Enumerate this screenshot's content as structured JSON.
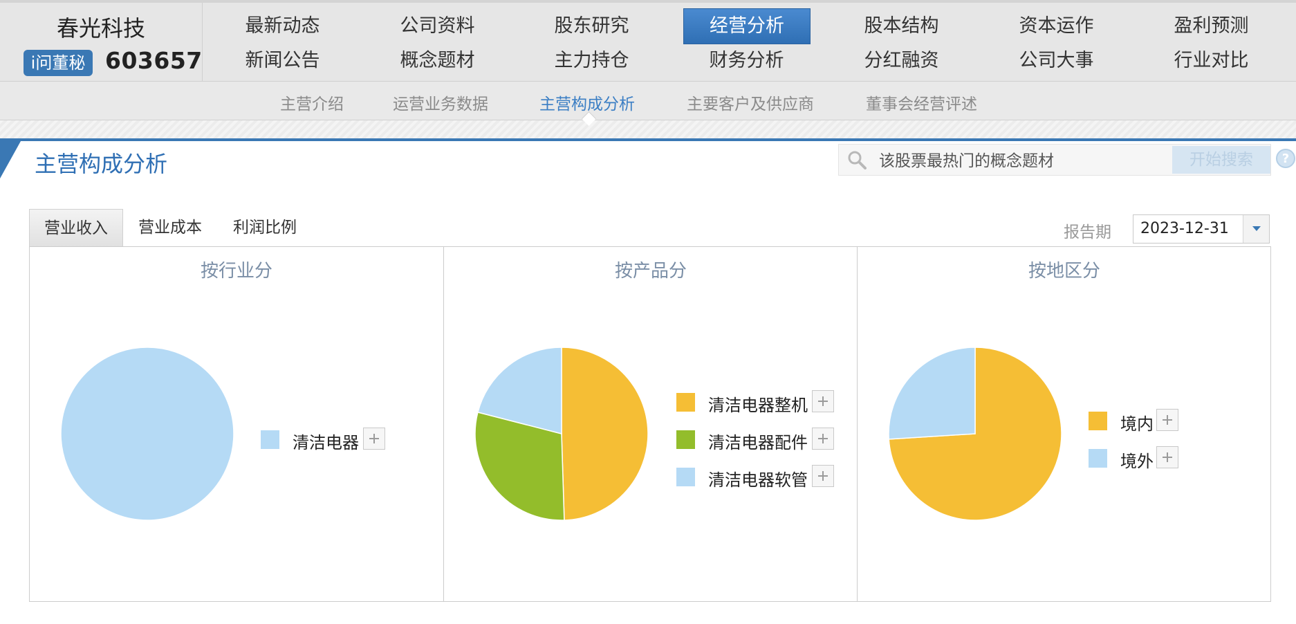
{
  "stock": {
    "name": "春光科技",
    "badge": "i问董秘",
    "code": "603657"
  },
  "nav": {
    "row1": [
      "最新动态",
      "公司资料",
      "股东研究",
      "经营分析",
      "股本结构",
      "资本运作",
      "盈利预测"
    ],
    "row2": [
      "新闻公告",
      "概念题材",
      "主力持仓",
      "财务分析",
      "分红融资",
      "公司大事",
      "行业对比"
    ],
    "active": "经营分析"
  },
  "subnav": {
    "items": [
      "主营介绍",
      "运营业务数据",
      "主营构成分析",
      "主要客户及供应商",
      "董事会经营评述"
    ],
    "active": "主营构成分析"
  },
  "section": {
    "title": "主营构成分析"
  },
  "search": {
    "placeholder": "该股票最热门的概念题材",
    "button_label": "开始搜索"
  },
  "tabs": {
    "items": [
      "营业收入",
      "营业成本",
      "利润比例"
    ],
    "active": "营业收入"
  },
  "report": {
    "label": "报告期",
    "value": "2023-12-31"
  },
  "colors": {
    "accent": "#3a78b4",
    "orange": "#f5be35",
    "green": "#93bd2b",
    "lightblue": "#b5daf5"
  },
  "chart_data": [
    {
      "type": "pie",
      "title": "按行业分",
      "categories": [
        "清洁电器"
      ],
      "values": [
        100
      ],
      "colors": [
        "#b5daf5"
      ]
    },
    {
      "type": "pie",
      "title": "按产品分",
      "categories": [
        "清洁电器整机",
        "清洁电器配件",
        "清洁电器软管"
      ],
      "values": [
        49.5,
        29.5,
        21.0
      ],
      "colors": [
        "#f5be35",
        "#93bd2b",
        "#b5daf5"
      ]
    },
    {
      "type": "pie",
      "title": "按地区分",
      "categories": [
        "境内",
        "境外"
      ],
      "values": [
        74,
        26
      ],
      "colors": [
        "#f5be35",
        "#b5daf5"
      ]
    }
  ]
}
